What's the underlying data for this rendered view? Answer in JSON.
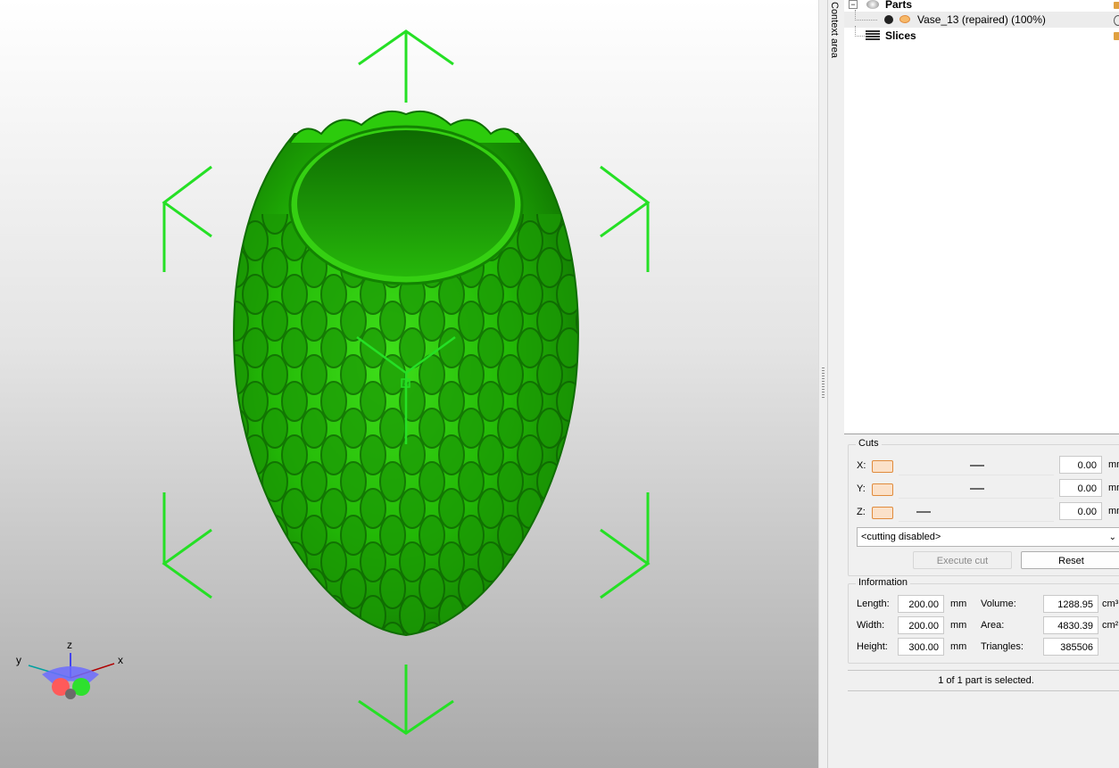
{
  "viewport": {
    "axis_labels": {
      "x": "x",
      "y": "y",
      "z": "z"
    },
    "model_color": "#2bc70a",
    "handle_color": "#25e025"
  },
  "context_tab": {
    "label": "Context area"
  },
  "tree": {
    "parts_label": "Parts",
    "part_name": "Vase_13 (repaired) (100%)",
    "slices_label": "Slices"
  },
  "cuts": {
    "title": "Cuts",
    "rows": [
      {
        "axis": "X:",
        "value": "0.00",
        "unit": "mm"
      },
      {
        "axis": "Y:",
        "value": "0.00",
        "unit": "mm"
      },
      {
        "axis": "Z:",
        "value": "0.00",
        "unit": "mm"
      }
    ],
    "mode": "<cutting disabled>",
    "execute_label": "Execute cut",
    "reset_label": "Reset"
  },
  "information": {
    "title": "Information",
    "length": {
      "label": "Length:",
      "value": "200.00",
      "unit": "mm"
    },
    "width": {
      "label": "Width:",
      "value": "200.00",
      "unit": "mm"
    },
    "height": {
      "label": "Height:",
      "value": "300.00",
      "unit": "mm"
    },
    "volume": {
      "label": "Volume:",
      "value": "1288.95",
      "unit": "cm³"
    },
    "area": {
      "label": "Area:",
      "value": "4830.39",
      "unit": "cm²"
    },
    "triangles": {
      "label": "Triangles:",
      "value": "385506"
    }
  },
  "status": {
    "text": "1 of 1 part is selected."
  },
  "colors": {
    "accent_orange": "#e08b3c",
    "model_green": "#2bc70a"
  }
}
